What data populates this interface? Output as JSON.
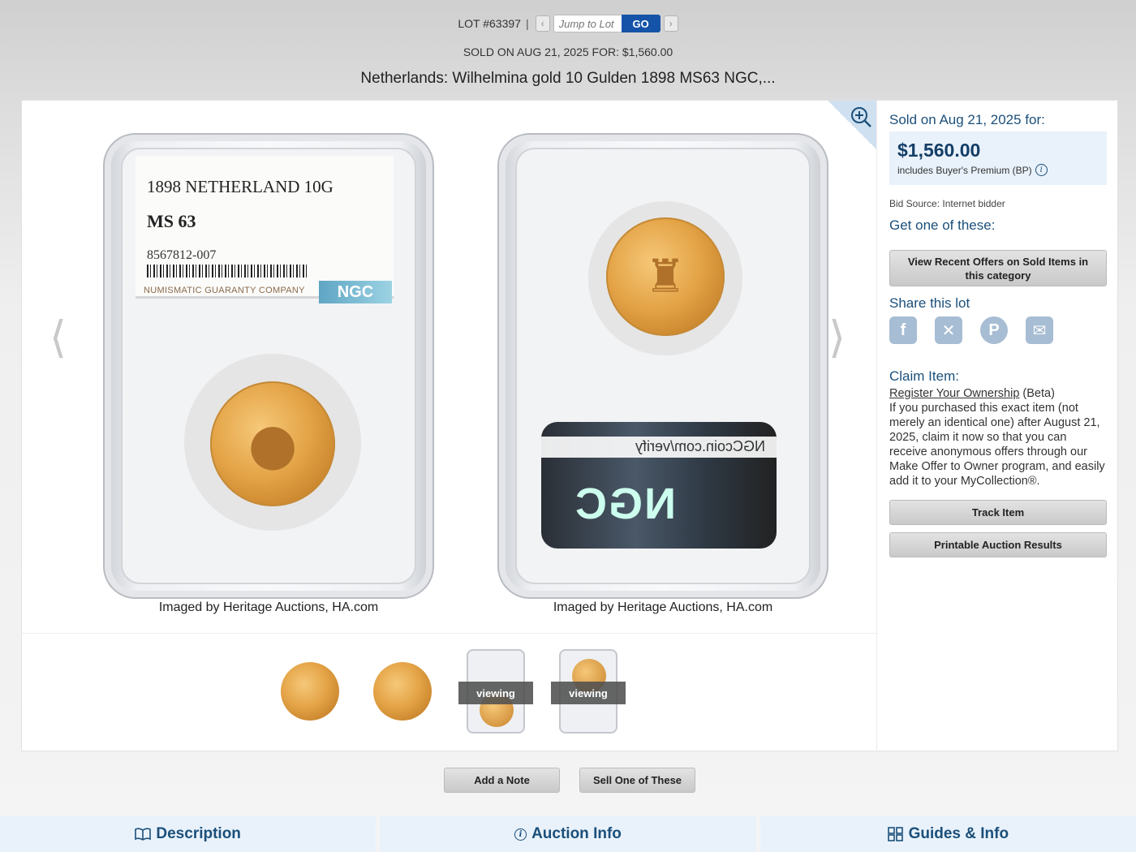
{
  "header": {
    "lot_number": "LOT #63397",
    "separator": "|",
    "jump_placeholder": "Jump to Lot",
    "go_label": "GO",
    "sold_line": "SOLD ON AUG 21, 2025 FOR: $1,560.00",
    "title": "Netherlands: Wilhelmina gold 10 Gulden 1898 MS63 NGC,..."
  },
  "gallery": {
    "front_label": {
      "line1": "1898 NETHERLAND 10G",
      "grade": "MS 63",
      "cert": "8567812-007",
      "company": "NUMISMATIC GUARANTY COMPANY",
      "logo": "NGC"
    },
    "back_label": {
      "url_text": "NGCcoin.com/verify",
      "logo": "NGC"
    },
    "credits": [
      "Imaged by Heritage Auctions, HA.com",
      "Imaged by Heritage Auctions, HA.com"
    ],
    "thumbnails": [
      {
        "kind": "coin-obverse",
        "viewing": ""
      },
      {
        "kind": "coin-reverse",
        "viewing": ""
      },
      {
        "kind": "slab-front",
        "viewing": "viewing"
      },
      {
        "kind": "slab-back",
        "viewing": "viewing"
      }
    ]
  },
  "sidebar": {
    "sold_on": "Sold on Aug 21, 2025 for:",
    "price": "$1,560.00",
    "bp_note": "includes Buyer's Premium (BP)",
    "bid_source": "Bid Source: Internet bidder",
    "get_one": "Get one of these:",
    "view_offers_btn": "View Recent Offers on Sold Items in this category",
    "share_title": "Share this lot",
    "share_icons": [
      "facebook-icon",
      "x-icon",
      "pinterest-icon",
      "email-icon"
    ],
    "claim_title": "Claim Item:",
    "claim_link": "Register Your Ownership",
    "claim_beta": " (Beta)",
    "claim_body": "If you purchased this exact item (not merely an identical one) after August 21, 2025, claim it now so that you can receive anonymous offers through our Make Offer to Owner program, and easily add it to your MyCollection®.",
    "track_btn": "Track Item",
    "printable_btn": "Printable Auction Results"
  },
  "actions": {
    "add_note": "Add a Note",
    "sell_one": "Sell One of These"
  },
  "tabs": [
    {
      "label": "Description",
      "icon": "book-icon"
    },
    {
      "label": "Auction Info",
      "icon": "info-icon"
    },
    {
      "label": "Guides & Info",
      "icon": "grid-icon"
    }
  ],
  "colors": {
    "accent_blue": "#1553a8",
    "text_blue": "#1b4f7a",
    "price_box_bg": "#e9f2fb"
  }
}
